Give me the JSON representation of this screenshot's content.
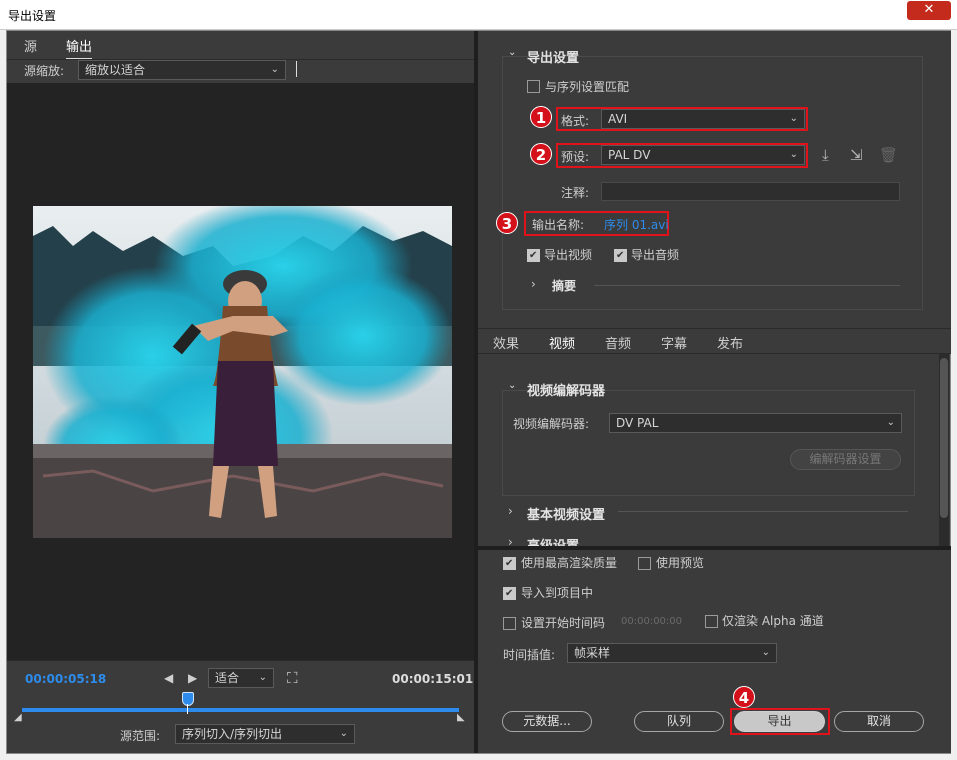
{
  "window": {
    "title": "导出设置",
    "close_label": "✕"
  },
  "left": {
    "tabs": [
      "源",
      "输出"
    ],
    "zoom_label": "源缩放:",
    "zoom_value": "缩放以适合",
    "timecode_current": "00:00:05:18",
    "fit_value": "适合",
    "timecode_end": "00:00:15:01",
    "range_label": "源范围:",
    "range_value": "序列切入/序列切出"
  },
  "export_settings": {
    "section_title": "导出设置",
    "match_sequence_label": "与序列设置匹配",
    "format_label": "格式:",
    "format_value": "AVI",
    "preset_label": "预设:",
    "preset_value": "PAL DV",
    "comments_label": "注释:",
    "output_name_label": "输出名称:",
    "output_name_value": "序列 01.avi",
    "export_video_label": "导出视频",
    "export_audio_label": "导出音频",
    "summary_label": "摘要"
  },
  "badges": [
    "1",
    "2",
    "3",
    "4"
  ],
  "tabs": [
    "效果",
    "视频",
    "音频",
    "字幕",
    "发布"
  ],
  "video": {
    "codec_section": "视频编解码器",
    "codec_label": "视频编解码器:",
    "codec_value": "DV PAL",
    "codec_settings_button": "编解码器设置",
    "basic_settings": "基本视频设置",
    "advanced_settings": "高级设置"
  },
  "bottom": {
    "max_render_quality": "使用最高渲染质量",
    "use_previews": "使用预览",
    "import_into_project": "导入到项目中",
    "set_start_timecode": "设置开始时间码",
    "start_timecode_value": "00:00:00:00",
    "render_alpha_only": "仅渲染 Alpha 通道",
    "interpolation_label": "时间插值:",
    "interpolation_value": "帧采样",
    "metadata_button": "元数据...",
    "queue_button": "队列",
    "export_button": "导出",
    "cancel_button": "取消"
  },
  "colors": {
    "accent": "#2d8ceb",
    "highlight_red": "#e0121a",
    "panel": "#3b3b3b",
    "preview_bg": "#232323"
  }
}
